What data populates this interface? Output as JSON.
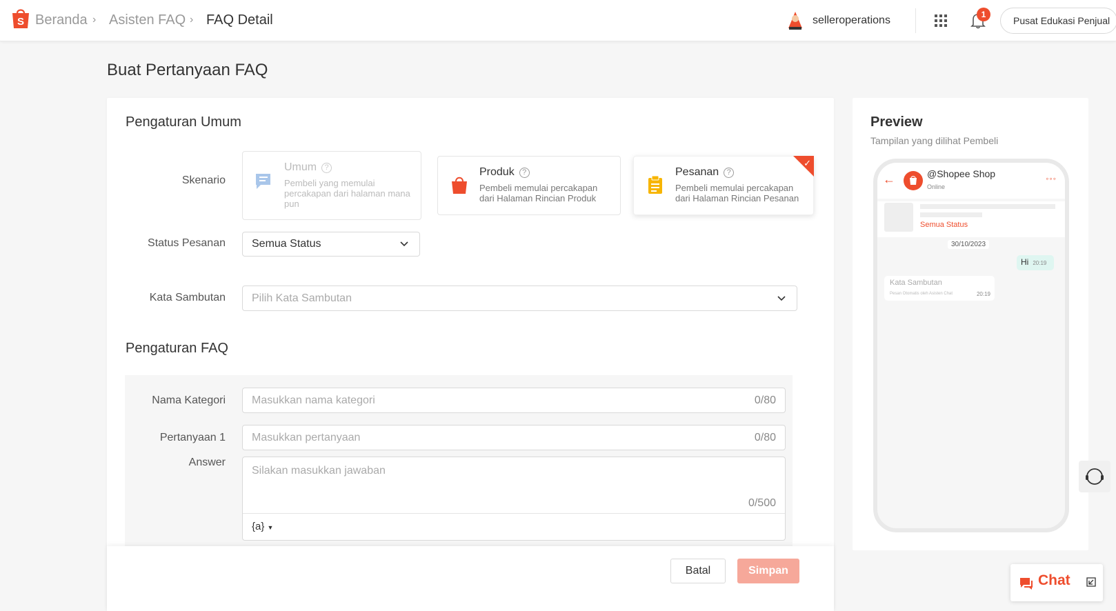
{
  "header": {
    "breadcrumbs": [
      "Beranda",
      "Asisten FAQ",
      "FAQ Detail"
    ],
    "username": "selleroperations",
    "notification_count": "1",
    "education_button": "Pusat Edukasi Penjual"
  },
  "page": {
    "title": "Buat Pertanyaan FAQ"
  },
  "general": {
    "section_title": "Pengaturan Umum",
    "scenario_label": "Skenario",
    "scenarios": [
      {
        "title": "Umum",
        "desc": "Pembeli yang memulai percakapan dari halaman mana pun",
        "state": "disabled",
        "icon": "chat-bubble-icon"
      },
      {
        "title": "Produk",
        "desc": "Pembeli memulai percakapan dari Halaman Rincian Produk",
        "state": "normal",
        "icon": "shopping-bag-icon"
      },
      {
        "title": "Pesanan",
        "desc": "Pembeli memulai percakapan dari Halaman Rincian Pesanan",
        "state": "selected",
        "icon": "clipboard-icon"
      }
    ],
    "status_label": "Status Pesanan",
    "status_value": "Semua Status",
    "greeting_label": "Kata Sambutan",
    "greeting_placeholder": "Pilih Kata Sambutan"
  },
  "faq": {
    "section_title": "Pengaturan FAQ",
    "category_label": "Nama Kategori",
    "category_placeholder": "Masukkan nama kategori",
    "category_count": "0/80",
    "question_label": "Pertanyaan 1",
    "question_placeholder": "Masukkan pertanyaan",
    "question_count": "0/80",
    "answer_label": "Answer",
    "answer_placeholder": "Silakan masukkan jawaban",
    "answer_count": "0/500",
    "variable_button": "{a}"
  },
  "footer": {
    "cancel": "Batal",
    "save": "Simpan"
  },
  "preview": {
    "title": "Preview",
    "subtitle": "Tampilan yang dilihat Pembeli",
    "shop_name": "@Shopee Shop",
    "online": "Online",
    "order_status": "Semua Status",
    "date": "30/10/2023",
    "hi_text": "Hi",
    "hi_time": "20:19",
    "greeting_text": "Kata Sambutan",
    "auto_note": "Pesan Otomatis oleh Asisten Chat",
    "greeting_time": "20:19"
  },
  "chat_widget": {
    "label": "Chat"
  },
  "colors": {
    "brand": "#ee4d2d",
    "disabled_save": "#f6a89a"
  }
}
